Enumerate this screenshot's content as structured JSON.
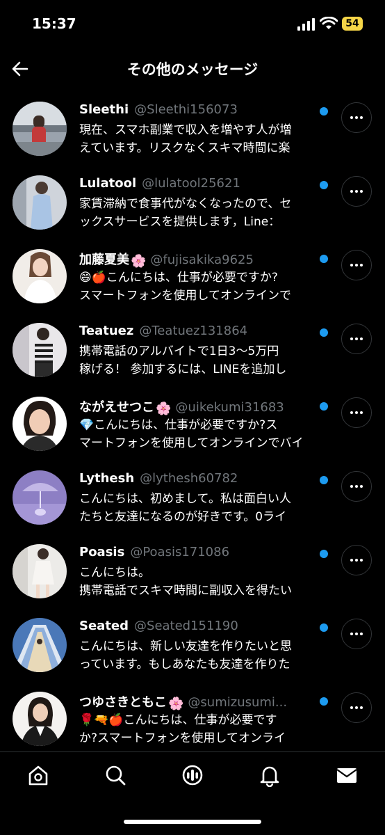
{
  "status": {
    "time": "15:37",
    "battery": "54"
  },
  "header": {
    "title": "その他のメッセージ"
  },
  "accent_color": "#1d9bf0",
  "messages": [
    {
      "name": "Sleethi",
      "emoji_after_name": "",
      "handle": "@Sleethi156073",
      "prefix_emoji": "",
      "line1": "現在、スマホ副業で収入を増やす人が増",
      "line2": "えています。リスクなくスキマ時間に楽",
      "avatar": "avatar-photo-woman-bridge",
      "unread": true
    },
    {
      "name": "Lulatool",
      "emoji_after_name": "",
      "handle": "@lulatool25621",
      "prefix_emoji": "",
      "line1": "家賃滞納で食事代がなくなったので、セ",
      "line2": "ックスサービスを提供します，Line：",
      "avatar": "avatar-photo-woman-dress",
      "unread": true
    },
    {
      "name": "加藤夏美",
      "emoji_after_name": "🌸",
      "handle": "@fujisakika9625",
      "prefix_emoji": "😄🍎",
      "line1": "こんにちは、仕事が必要ですか?",
      "line2": "スマートフォンを使用してオンラインで",
      "avatar": "avatar-photo-woman-white",
      "unread": true
    },
    {
      "name": "Teatuez",
      "emoji_after_name": "",
      "handle": "@Teatuez131864",
      "prefix_emoji": "",
      "line1": "携帯電話のアルバイトで1日3～5万円",
      "line2": "稼げる！ 参加するには、LINEを追加し",
      "avatar": "avatar-photo-woman-stripes",
      "unread": true
    },
    {
      "name": "ながえせつこ",
      "emoji_after_name": "🌸",
      "handle": "@uikekumi31683",
      "prefix_emoji": "💎",
      "line1": "こんにちは、仕事が必要ですか?ス",
      "line2": "マートフォンを使用してオンラインでバイ",
      "avatar": "avatar-photo-woman-smile",
      "unread": true
    },
    {
      "name": "Lythesh",
      "emoji_after_name": "",
      "handle": "@lythesh60782",
      "prefix_emoji": "",
      "line1": "こんにちは、初めまして。私は面白い人",
      "line2": "たちと友達になるのが好きです。0ライ",
      "avatar": "avatar-photo-purple-umbrella",
      "unread": true
    },
    {
      "name": "Poasis",
      "emoji_after_name": "",
      "handle": "@Poasis171086",
      "prefix_emoji": "",
      "line1": "こんにちは。",
      "line2": "携帯電話でスキマ時間に副収入を得たい",
      "avatar": "avatar-photo-woman-skirt",
      "unread": true
    },
    {
      "name": "Seated",
      "emoji_after_name": "",
      "handle": "@Seated151190",
      "prefix_emoji": "",
      "line1": "こんにちは、新しい友達を作りたいと思",
      "line2": "っています。もしあなたも友達を作りた",
      "avatar": "avatar-photo-blue-tiles",
      "unread": true
    },
    {
      "name": "つゆさきともこ",
      "emoji_after_name": "🌸",
      "handle": "@sumizusumi...",
      "prefix_emoji": "🌹🔫🍎",
      "line1": "こんにちは、仕事が必要です",
      "line2": "か?スマートフォンを使用してオンライ",
      "avatar": "avatar-photo-woman-suit",
      "unread": true
    }
  ],
  "tabbar": {
    "items": [
      "home-icon",
      "search-icon",
      "spaces-icon",
      "notifications-icon",
      "messages-icon"
    ]
  }
}
